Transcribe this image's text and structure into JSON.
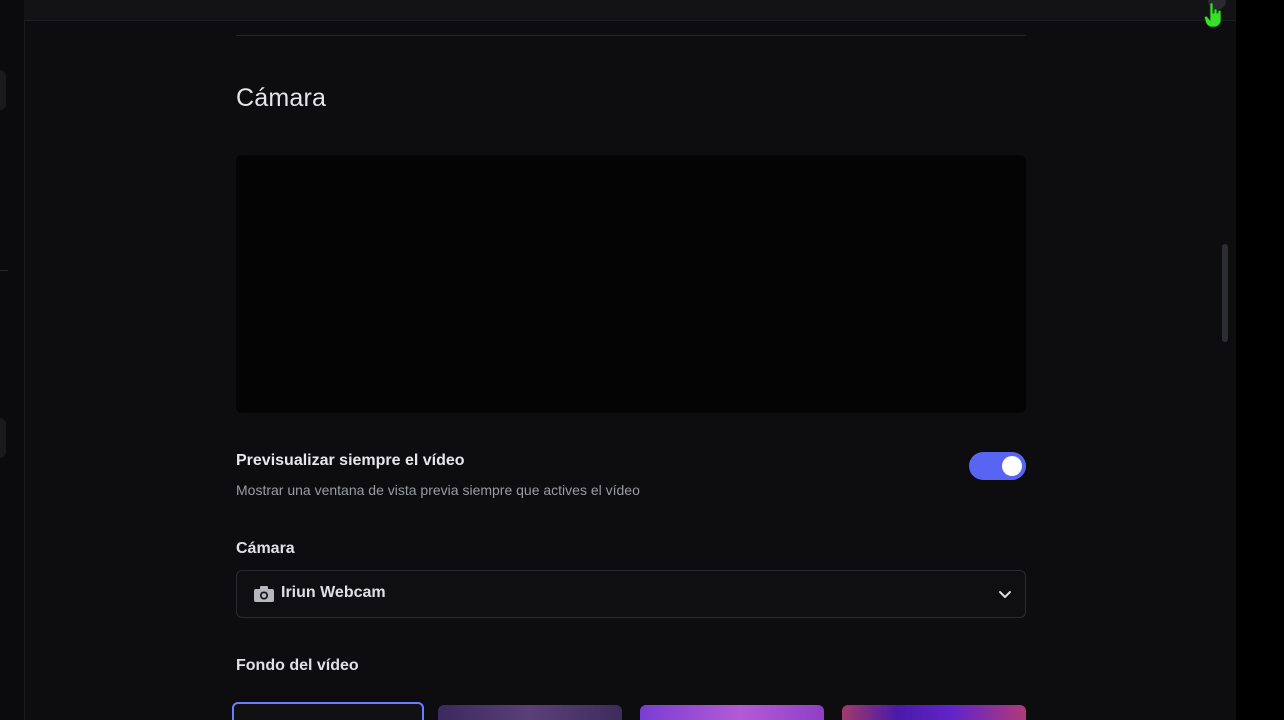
{
  "section": {
    "title": "Cámara"
  },
  "preview_toggle": {
    "title": "Previsualizar siempre el vídeo",
    "description": "Mostrar una ventana de vista previa siempre que actives el vídeo",
    "enabled": true
  },
  "camera_field": {
    "label": "Cámara",
    "selected_value": "Iriun Webcam",
    "icon": "camera-icon"
  },
  "background": {
    "label": "Fondo del vídeo",
    "selected_index": 0
  },
  "colors": {
    "accent": "#5865f2",
    "background": "#0d0d0f",
    "preview": "#040405"
  }
}
